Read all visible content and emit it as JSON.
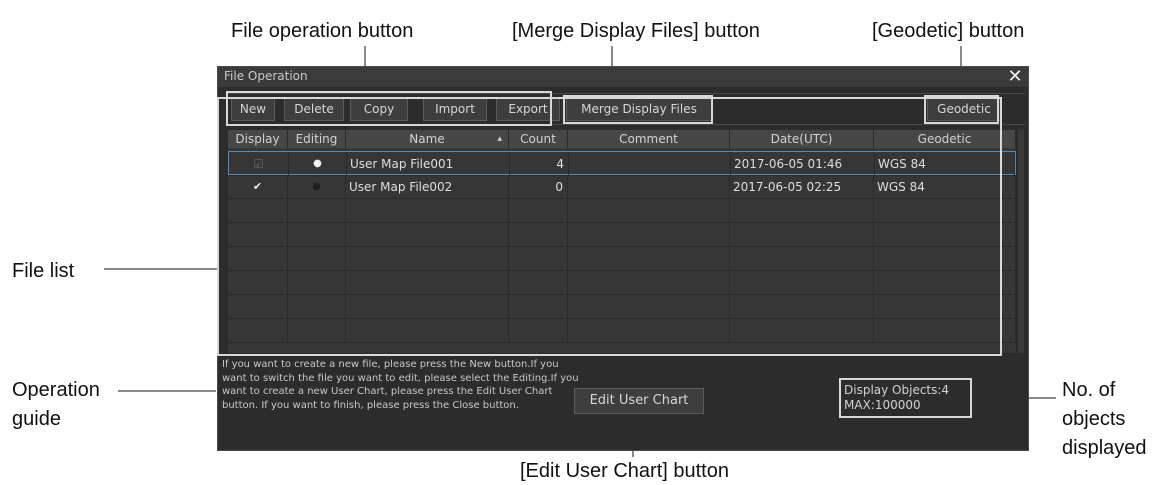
{
  "callouts": {
    "file_operation_button": "File operation button",
    "merge_display_files_button": "[Merge Display Files] button",
    "geodetic_button": "[Geodetic] button",
    "file_list": "File list",
    "operation_guide_line1": "Operation",
    "operation_guide_line2": "guide",
    "objects_line1": "No. of",
    "objects_line2": "objects",
    "objects_line3": "displayed",
    "edit_user_chart_button": "[Edit User Chart] button"
  },
  "window": {
    "title": "File Operation",
    "close_glyph": "✕"
  },
  "toolbar": {
    "new_label": "New",
    "delete_label": "Delete",
    "copy_label": "Copy",
    "import_label": "Import",
    "export_label": "Export",
    "merge_label": "Merge Display Files",
    "geodetic_label": "Geodetic"
  },
  "table": {
    "columns": [
      "Display",
      "Editing",
      "Name",
      "Count",
      "Comment",
      "Date(UTC)",
      "Geodetic"
    ],
    "sort_indicator": "▴",
    "rows": [
      {
        "display": "☑",
        "editing": "●",
        "name": "User Map File001",
        "count": "4",
        "comment": "",
        "date": "2017-06-05 01:46",
        "geodetic": "WGS 84"
      },
      {
        "display": "✔",
        "editing": "●",
        "name": "User Map File002",
        "count": "0",
        "comment": "",
        "date": "2017-06-05 02:25",
        "geodetic": "WGS 84"
      }
    ]
  },
  "guide": {
    "text": "If you want to create a new file, please press the New button.If you want to switch the file you want to edit, please select the Editing.If you want to create a new User Chart, please press the Edit User Chart button. If you want to finish, please press the Close button."
  },
  "edit_user_chart_label": "Edit User Chart",
  "objects": {
    "display_objects": "Display Objects:4",
    "max": "MAX:100000"
  }
}
